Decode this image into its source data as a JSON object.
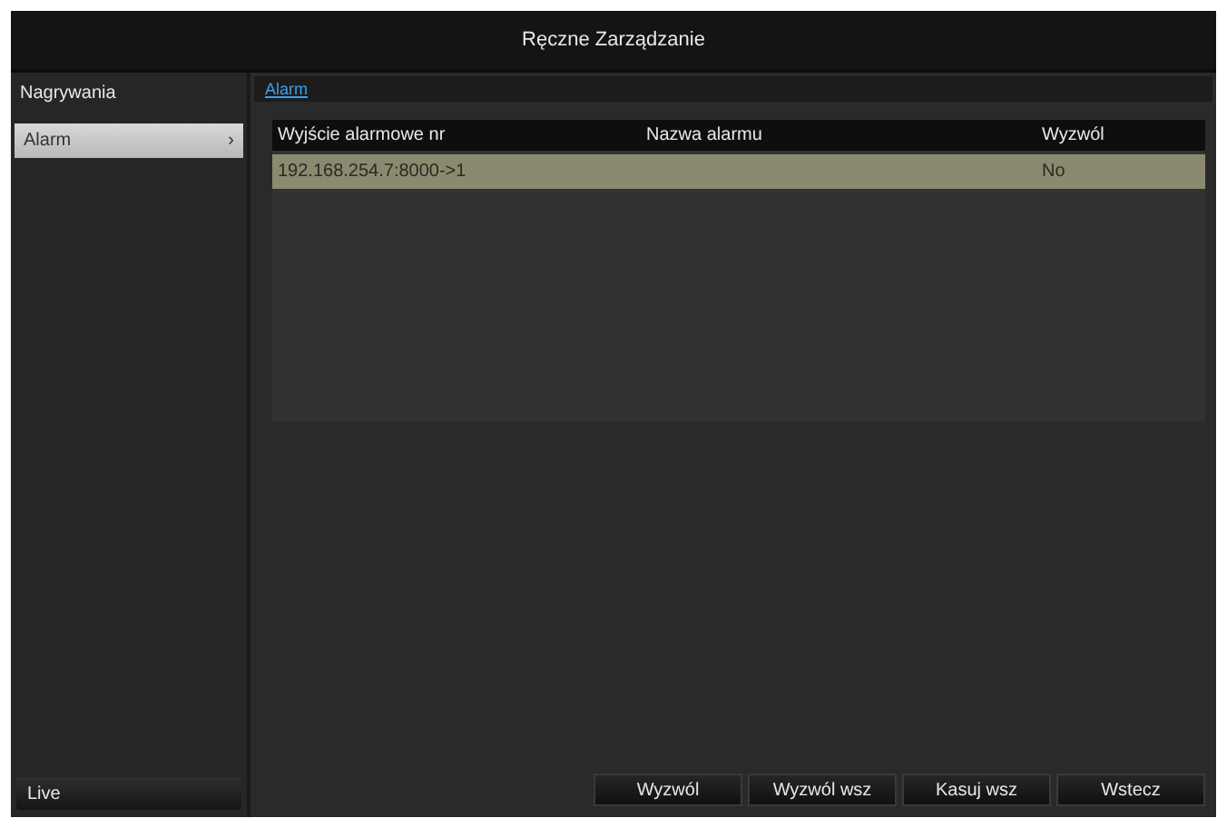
{
  "window": {
    "title": "Ręczne Zarządzanie"
  },
  "sidebar": {
    "heading": "Nagrywania",
    "items": [
      {
        "label": "Alarm",
        "chevron": "›",
        "selected": true
      }
    ],
    "footer": "Live"
  },
  "section": {
    "title": "Alarm"
  },
  "table": {
    "columns": [
      "Wyjście alarmowe nr",
      "Nazwa alarmu",
      "Wyzwól"
    ],
    "rows": [
      {
        "cells": [
          "192.168.254.7:8000->1",
          "",
          "No"
        ],
        "selected": true
      }
    ]
  },
  "buttons": [
    "Wyzwól",
    "Wyzwól wsz",
    "Kasuj wsz",
    "Wstecz"
  ]
}
